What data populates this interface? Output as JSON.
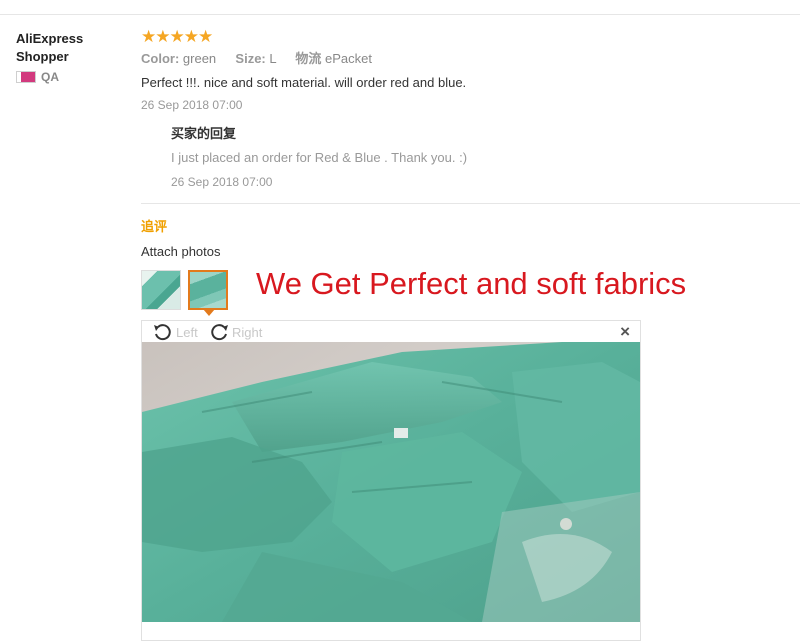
{
  "reviewer": {
    "name": "AliExpress Shopper",
    "country": "QA"
  },
  "review": {
    "stars": "★★★★★",
    "rating": 5,
    "color_label": "Color:",
    "color_value": "green",
    "size_label": "Size:",
    "size_value": "L",
    "shipping_label": "物流",
    "shipping_value": "ePacket",
    "text": "Perfect !!!. nice and soft material. will order red and blue.",
    "date": "26 Sep 2018 07:00"
  },
  "reply": {
    "title": "买家的回复",
    "text": "I just placed an order for Red & Blue . Thank you. :)",
    "date": "26 Sep 2018 07:00"
  },
  "followup": {
    "label": "追评",
    "attach_label": "Attach photos"
  },
  "annotation": "We Get Perfect and soft fabrics",
  "viewer": {
    "rotate_left": "Left",
    "rotate_right": "Right",
    "close": "×"
  },
  "colors": {
    "star": "#f5a623",
    "followup": "#f0a000",
    "annotation": "#d8181f",
    "fabric": "#5fb7a0",
    "selected_thumb_border": "#e37a1c"
  }
}
